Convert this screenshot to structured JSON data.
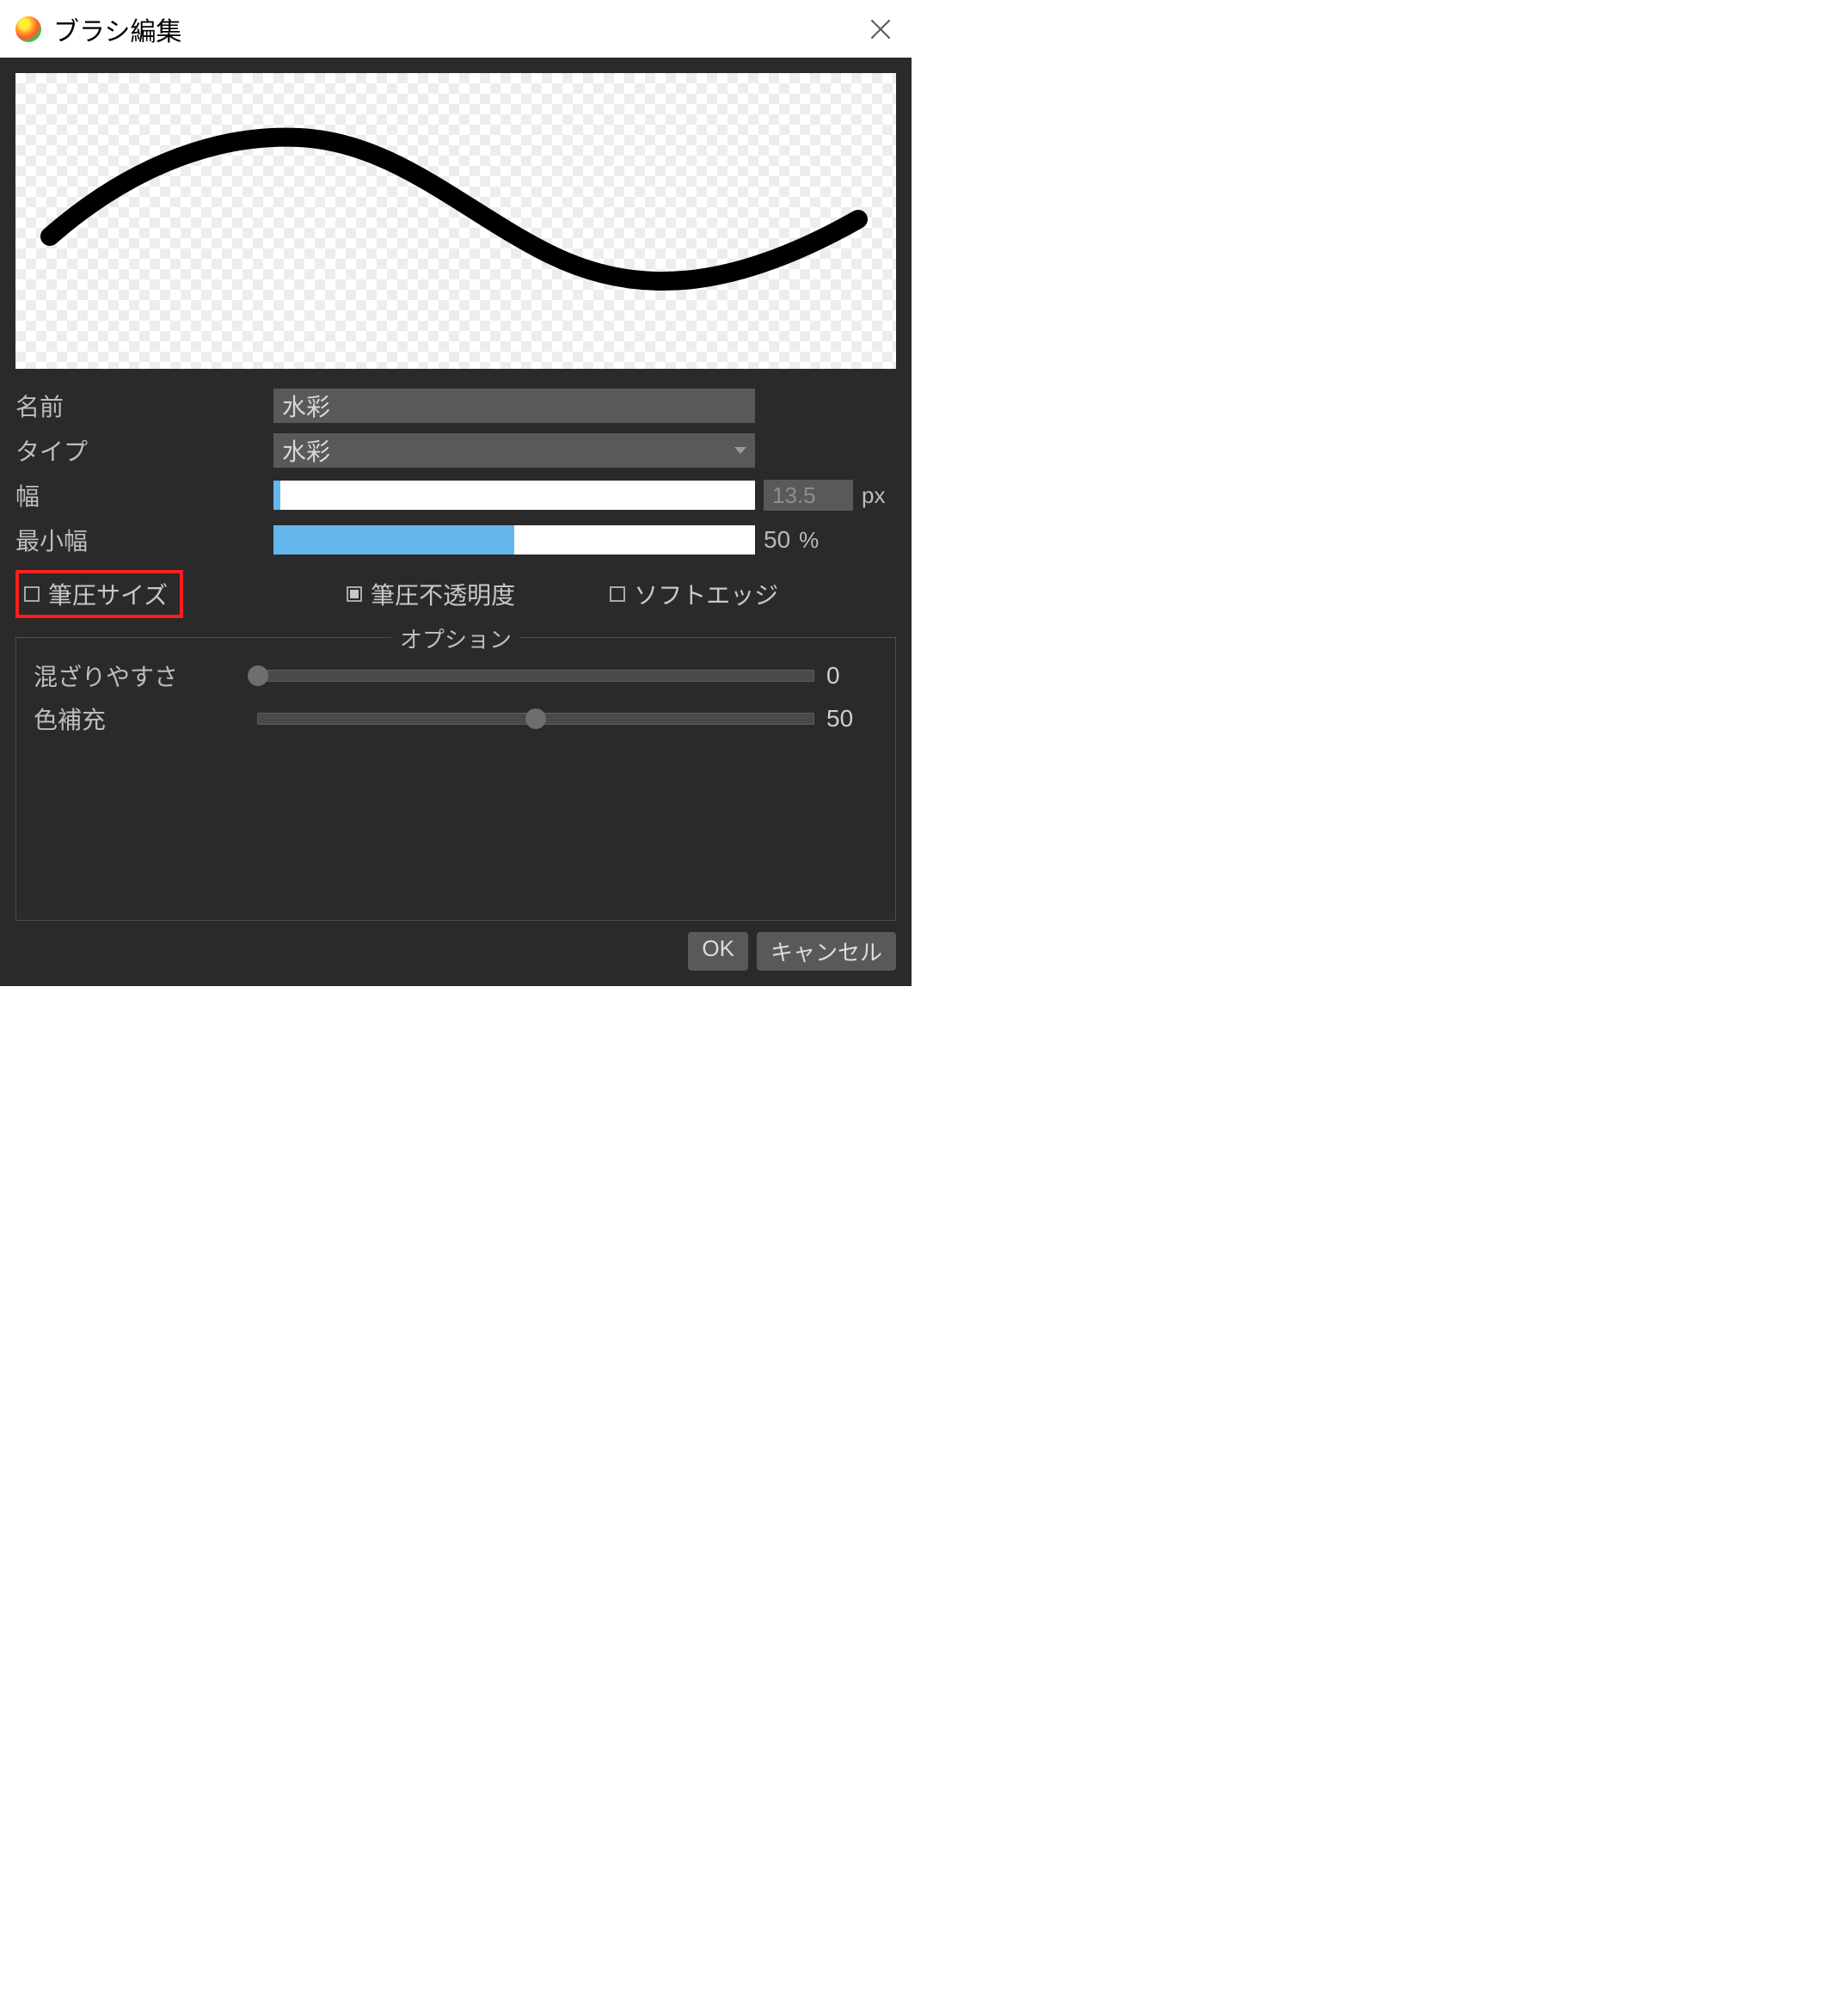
{
  "window": {
    "title": "ブラシ編集"
  },
  "fields": {
    "name": {
      "label": "名前",
      "value": "水彩"
    },
    "type": {
      "label": "タイプ",
      "value": "水彩"
    },
    "width": {
      "label": "幅",
      "value": "13.5",
      "unit": "px",
      "fill_percent": 1.5
    },
    "min_width": {
      "label": "最小幅",
      "value": "50",
      "unit": "%",
      "fill_percent": 50
    }
  },
  "checks": {
    "pressure_size": {
      "label": "筆圧サイズ",
      "checked": false,
      "highlighted": true
    },
    "pressure_opacity": {
      "label": "筆圧不透明度",
      "checked": true
    },
    "soft_edge": {
      "label": "ソフトエッジ",
      "checked": false
    }
  },
  "options": {
    "legend": "オプション",
    "mix": {
      "label": "混ざりやすさ",
      "value": "0",
      "percent": 0
    },
    "refill": {
      "label": "色補充",
      "value": "50",
      "percent": 50
    }
  },
  "buttons": {
    "ok": "OK",
    "cancel": "キャンセル"
  }
}
